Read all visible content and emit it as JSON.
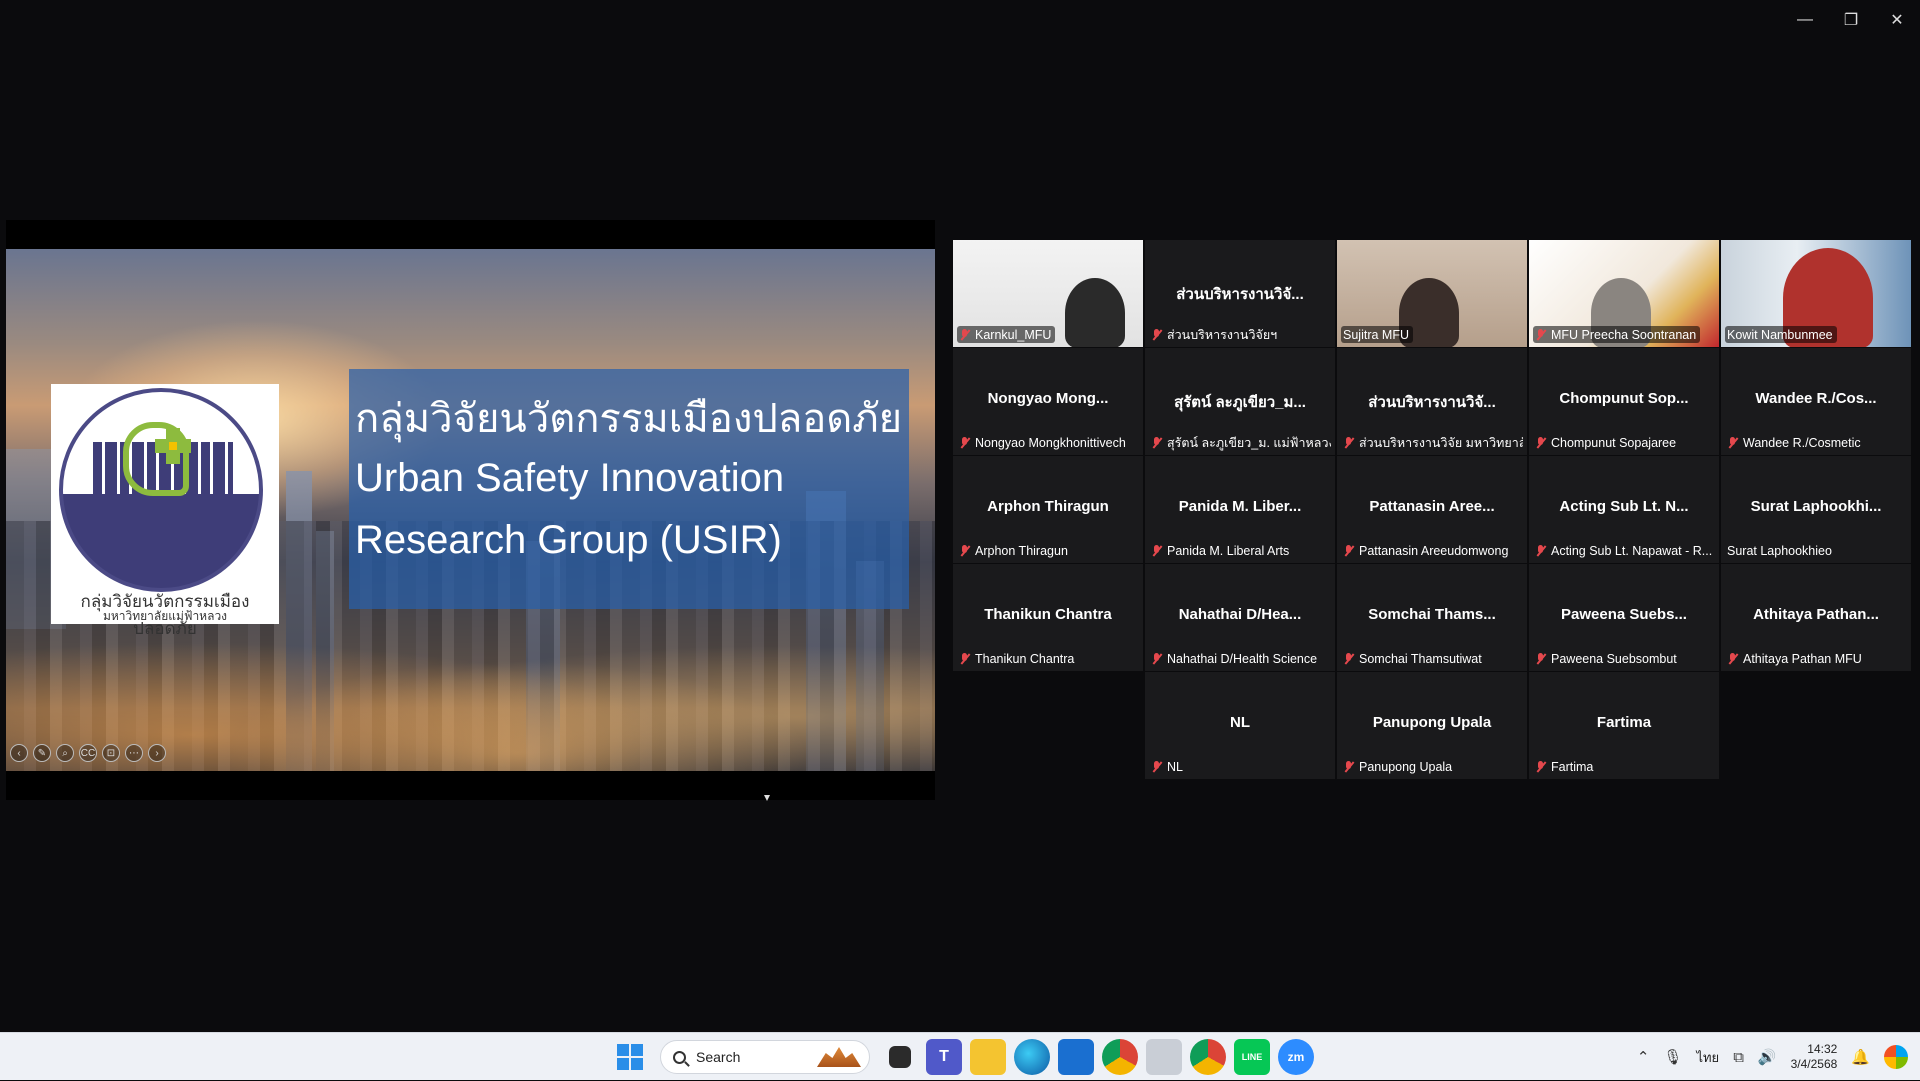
{
  "window": {
    "minimize_glyph": "—",
    "restore_glyph": "❐",
    "close_glyph": "✕"
  },
  "slide": {
    "title_thai": "กลุ่มวิจัยนวัตกรรมเมืองปลอดภัย",
    "title_en_line1": "Urban Safety Innovation",
    "title_en_line2": "Research Group (USIR)",
    "logo_text_line1": "กลุ่มวิจัยนวัตกรรมเมืองปลอดภัย",
    "logo_text_line2": "มหาวิทยาลัยแม่ฟ้าหลวง"
  },
  "annotation_toolbar": [
    "‹",
    "✎",
    "⌕",
    "CC",
    "⊡",
    "⋯",
    "›"
  ],
  "participants": [
    {
      "name": "Karnkul_MFU",
      "big": "",
      "video": true,
      "muted": true
    },
    {
      "name": "ส่วนบริหารงานวิจัยฯ",
      "big": "ส่วนบริหารงานวิจั...",
      "video": false,
      "muted": true
    },
    {
      "name": "Sujitra MFU",
      "big": "",
      "video": true,
      "muted": false
    },
    {
      "name": "MFU Preecha Soontranan",
      "big": "",
      "video": true,
      "muted": true
    },
    {
      "name": "Kowit Nambunmee",
      "big": "",
      "video": true,
      "muted": false,
      "active": true
    },
    {
      "name": "Nongyao Mongkhonittivech",
      "big": "Nongyao Mong...",
      "video": false,
      "muted": true
    },
    {
      "name": "สุรัตน์ ละภูเขียว_ม. แม่ฟ้าหลวง",
      "big": "สุรัตน์ ละภูเขียว_ม...",
      "video": false,
      "muted": true
    },
    {
      "name": "ส่วนบริหารงานวิจัย มหาวิทยาลั...",
      "big": "ส่วนบริหารงานวิจั...",
      "video": false,
      "muted": true
    },
    {
      "name": "Chompunut Sopajaree",
      "big": "Chompunut Sop...",
      "video": false,
      "muted": true
    },
    {
      "name": "Wandee R./Cosmetic",
      "big": "Wandee R./Cos...",
      "video": false,
      "muted": true
    },
    {
      "name": "Arphon Thiragun",
      "big": "Arphon Thiragun",
      "video": false,
      "muted": true
    },
    {
      "name": "Panida M. Liberal Arts",
      "big": "Panida M. Liber...",
      "video": false,
      "muted": true
    },
    {
      "name": "Pattanasin Areeudomwong",
      "big": "Pattanasin Aree...",
      "video": false,
      "muted": true
    },
    {
      "name": "Acting Sub Lt. Napawat - R...",
      "big": "Acting Sub Lt. N...",
      "video": false,
      "muted": true
    },
    {
      "name": "Surat Laphookhieo",
      "big": "Surat Laphookhi...",
      "video": false,
      "muted": false
    },
    {
      "name": "Thanikun Chantra",
      "big": "Thanikun Chantra",
      "video": false,
      "muted": true
    },
    {
      "name": "Nahathai D/Health Science",
      "big": "Nahathai D/Hea...",
      "video": false,
      "muted": true
    },
    {
      "name": "Somchai Thamsutiwat",
      "big": "Somchai Thams...",
      "video": false,
      "muted": true
    },
    {
      "name": "Paweena Suebsombut",
      "big": "Paweena Suebs...",
      "video": false,
      "muted": true
    },
    {
      "name": "Athitaya Pathan MFU",
      "big": "Athitaya Pathan...",
      "video": false,
      "muted": true
    },
    {
      "name": "NL",
      "big": "NL",
      "video": false,
      "muted": true
    },
    {
      "name": "Panupong Upala",
      "big": "Panupong Upala",
      "video": false,
      "muted": true
    },
    {
      "name": "Fartima",
      "big": "Fartima",
      "video": false,
      "muted": true
    }
  ],
  "taskbar": {
    "search_placeholder": "Search",
    "apps": [
      "file-explorer",
      "teams",
      "folder",
      "edge",
      "store",
      "chrome",
      "gallery",
      "chrome-profile",
      "line",
      "zoom"
    ],
    "app_labels": {
      "teams": "T",
      "line": "LINE",
      "zoom": "zm"
    },
    "tray": {
      "chevron": "⌃",
      "mic": "🎙",
      "lang": "ไทย",
      "network": "⧉",
      "volume": "🔊",
      "bell": "🔔",
      "time": "14:32",
      "date": "3/4/2568"
    }
  }
}
